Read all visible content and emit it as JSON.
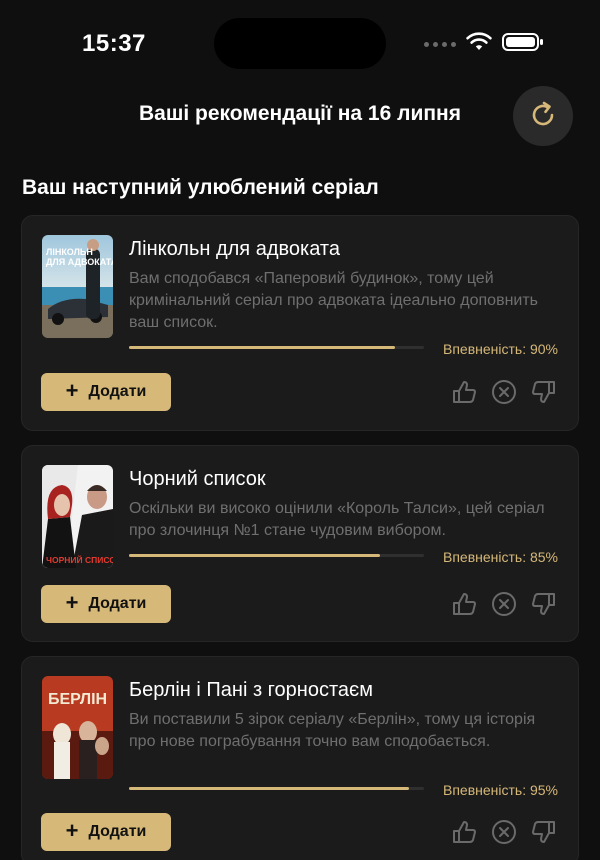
{
  "status_bar": {
    "time": "15:37"
  },
  "header": {
    "title": "Ваші рекомендації на 16 липня",
    "refresh_icon": "refresh-icon"
  },
  "section": {
    "title": "Ваш наступний улюблений серіал"
  },
  "colors": {
    "accent": "#d6b878",
    "background": "#0f0f0f",
    "card": "#1b1b1b"
  },
  "recommendations": [
    {
      "title": "Лінкольн для адвоката",
      "poster_text": "ЛІНКОЛЬН ДЛЯ АДВОКАТА",
      "description": "Вам сподобався «Паперовий будинок», тому цей кримінальний серіал про адвоката ідеально доповнить ваш список.",
      "confidence_label": "Впевненість: 90%",
      "confidence": 0.9,
      "add_label": "Додати"
    },
    {
      "title": "Чорний список",
      "poster_text": "ЧОРНИЙ СПИСОК",
      "description": "Оскільки ви високо оцінили «Король Талси», цей серіал про злочинця №1 стане чудовим вибором.",
      "confidence_label": "Впевненість: 85%",
      "confidence": 0.85,
      "add_label": "Додати"
    },
    {
      "title": "Берлін і Пані з горностаєм",
      "poster_text": "БЕРЛІН",
      "description": "Ви поставили 5 зірок серіалу «Берлін», тому ця історія про нове пограбування точно вам сподобається.",
      "confidence_label": "Впевненість: 95%",
      "confidence": 0.95,
      "add_label": "Додати"
    }
  ]
}
